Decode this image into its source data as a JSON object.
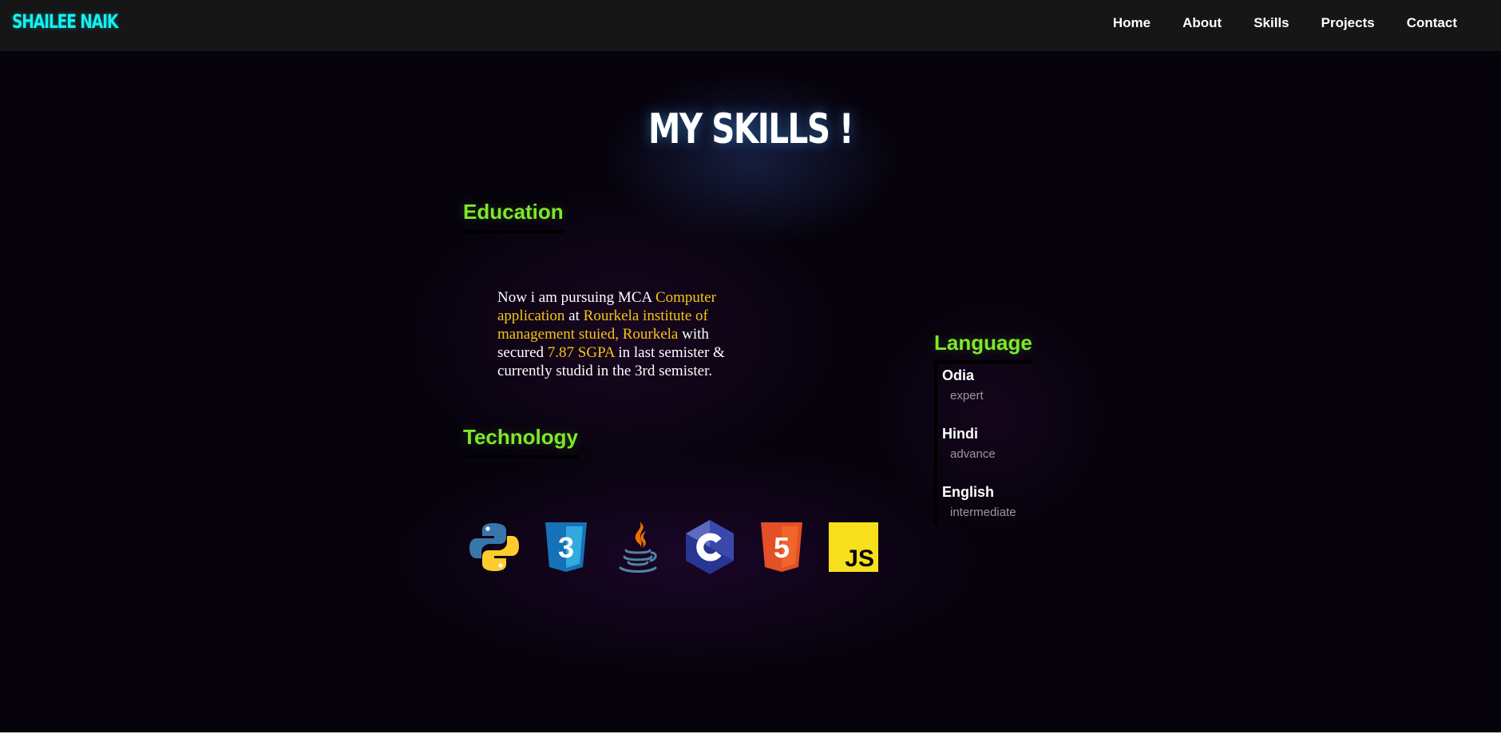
{
  "navbar": {
    "logo": "SHAILEE NAIK",
    "links": [
      "Home",
      "About",
      "Skills",
      "Projects",
      "Contact"
    ]
  },
  "skills": {
    "title": "MY SKILLS !",
    "education": {
      "heading": "Education",
      "t1": "Now i am pursuing MCA ",
      "hl1": "Computer application",
      "t2": " at ",
      "hl2": "Rourkela institute of management stuied, Rourkela",
      "t3": " with secured ",
      "hl3": "7.87 SGPA",
      "t4": " in last semister & currently studid in the 3rd semister."
    },
    "technology": {
      "heading": "Technology",
      "icons": [
        "python-icon",
        "css3-icon",
        "java-icon",
        "c-icon",
        "html5-icon",
        "javascript-icon"
      ],
      "js_label": "JS",
      "css_label": "3",
      "html_label": "5"
    },
    "language": {
      "heading": "Language",
      "items": [
        {
          "name": "Odia",
          "level": "expert"
        },
        {
          "name": "Hindi",
          "level": "advance"
        },
        {
          "name": "English",
          "level": "intermediate"
        }
      ]
    }
  },
  "colors": {
    "accent_cyan": "#12f2f2",
    "accent_green": "#7ee82a",
    "highlight_yellow": "#f5c518",
    "background": "#07030d",
    "navbar_bg": "#161616"
  }
}
